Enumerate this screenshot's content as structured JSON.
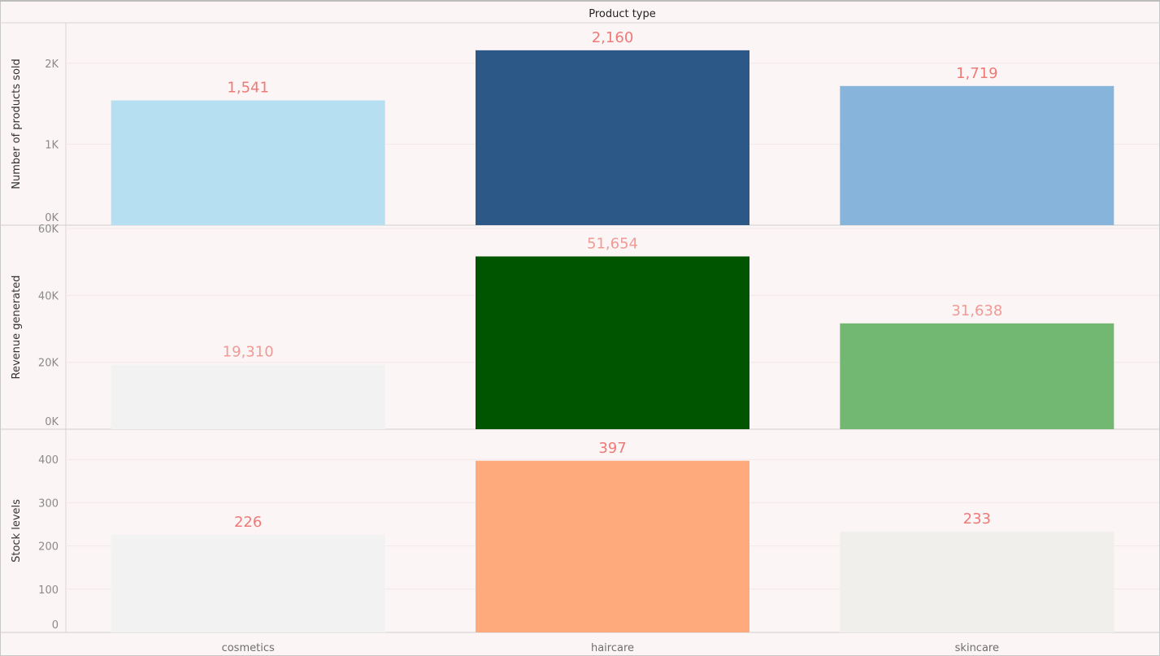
{
  "chart_data": {
    "type": "bar",
    "header": "Product type",
    "categories": [
      "cosmetics",
      "haircare",
      "skincare"
    ],
    "panels": [
      {
        "ylabel": "Number of products sold",
        "values": [
          1541,
          2160,
          1719
        ],
        "labels": [
          "1,541",
          "2,160",
          "1,719"
        ],
        "ylim": [
          0,
          2500
        ],
        "ticks": [
          0,
          1000,
          2000
        ],
        "tick_labels": [
          "0K",
          "1K",
          "2K"
        ],
        "colors": [
          "#b7dff2",
          "#2b5886",
          "#87b4da"
        ],
        "label_color": "#ee7a76"
      },
      {
        "ylabel": "Revenue generated",
        "values": [
          19310,
          51654,
          31638
        ],
        "labels": [
          "19,310",
          "51,654",
          "31,638"
        ],
        "ylim": [
          0,
          61000
        ],
        "ticks": [
          0,
          20000,
          40000,
          60000
        ],
        "tick_labels": [
          "0K",
          "20K",
          "40K",
          "60K"
        ],
        "colors": [
          "#f2f2f2",
          "#005500",
          "#72b772"
        ],
        "label_color": "#f09a96"
      },
      {
        "ylabel": "Stock levels",
        "values": [
          226,
          397,
          233
        ],
        "labels": [
          "226",
          "397",
          "233"
        ],
        "ylim": [
          0,
          470
        ],
        "ticks": [
          0,
          100,
          200,
          300,
          400
        ],
        "tick_labels": [
          "0",
          "100",
          "200",
          "300",
          "400"
        ],
        "colors": [
          "#f2f2f2",
          "#ffaa7d",
          "#f0efec"
        ],
        "label_color": "#ee7a76"
      }
    ],
    "grid": true,
    "legend": "none"
  }
}
